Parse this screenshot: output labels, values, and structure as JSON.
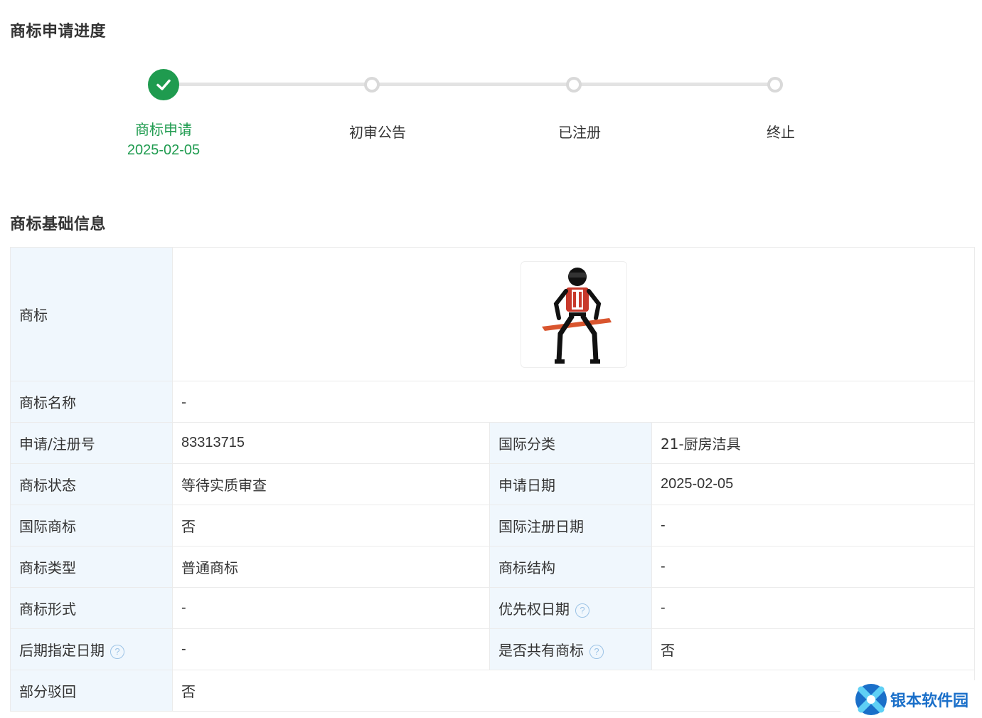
{
  "progress": {
    "title": "商标申请进度",
    "steps": [
      {
        "label": "商标申请",
        "date": "2025-02-05",
        "status": "done"
      },
      {
        "label": "初审公告",
        "date": "",
        "status": "pending"
      },
      {
        "label": "已注册",
        "date": "",
        "status": "pending"
      },
      {
        "label": "终止",
        "date": "",
        "status": "pending"
      }
    ]
  },
  "basic_info": {
    "title": "商标基础信息",
    "logo_label": "商标",
    "name_label": "商标名称",
    "name_value": "-",
    "rows": [
      {
        "l1": "申请/注册号",
        "v1": "83313715",
        "l2": "国际分类",
        "v2": "21-厨房洁具",
        "h1": false,
        "h2": false
      },
      {
        "l1": "商标状态",
        "v1": "等待实质审查",
        "l2": "申请日期",
        "v2": "2025-02-05",
        "h1": false,
        "h2": false
      },
      {
        "l1": "国际商标",
        "v1": "否",
        "l2": "国际注册日期",
        "v2": "-",
        "h1": false,
        "h2": false
      },
      {
        "l1": "商标类型",
        "v1": "普通商标",
        "l2": "商标结构",
        "v2": "-",
        "h1": false,
        "h2": false
      },
      {
        "l1": "商标形式",
        "v1": "-",
        "l2": "优先权日期",
        "v2": "-",
        "h1": false,
        "h2": true
      },
      {
        "l1": "后期指定日期",
        "v1": "-",
        "l2": "是否共有商标",
        "v2": "否",
        "h1": true,
        "h2": true
      }
    ],
    "partial_label": "部分驳回",
    "partial_value": "否"
  },
  "help_glyph": "?",
  "watermark": {
    "text": "银本软件园"
  },
  "colors": {
    "accent_green": "#1f9b4f",
    "label_bg": "#f0f7fd",
    "border": "#ebebeb",
    "track": "#e3e3e3",
    "help": "#9cc3e6",
    "brand_blue": "#1a6fc9"
  }
}
